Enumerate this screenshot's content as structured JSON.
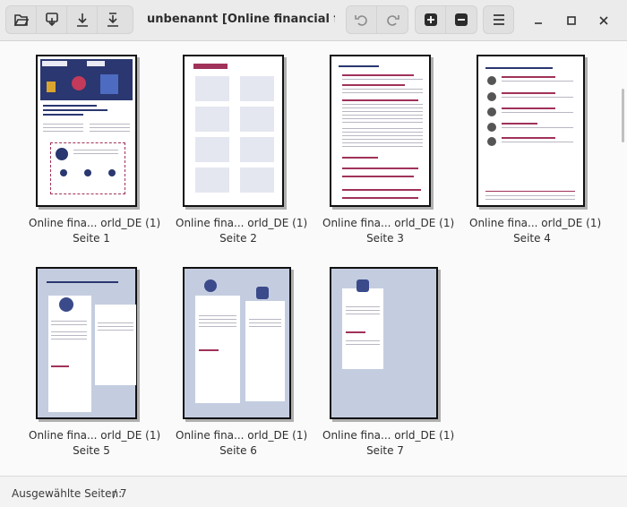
{
  "header": {
    "title": "unbenannt [Online financial frauds ...",
    "buttons": {
      "open": "folder-open-icon",
      "save": "save-icon",
      "download": "download-icon",
      "download_to": "download-to-icon",
      "undo": "undo-icon",
      "redo": "redo-icon",
      "zoom_in": "plus-icon",
      "zoom_out": "minus-icon",
      "menu": "hamburger-menu-icon"
    }
  },
  "pages": [
    {
      "name": "Online fina... orld_DE (1)",
      "label": "Seite 1"
    },
    {
      "name": "Online fina... orld_DE (1)",
      "label": "Seite 2"
    },
    {
      "name": "Online fina... orld_DE (1)",
      "label": "Seite 3"
    },
    {
      "name": "Online fina... orld_DE (1)",
      "label": "Seite 4"
    },
    {
      "name": "Online fina... orld_DE (1)",
      "label": "Seite 5"
    },
    {
      "name": "Online fina... orld_DE (1)",
      "label": "Seite 6"
    },
    {
      "name": "Online fina... orld_DE (1)",
      "label": "Seite 7"
    }
  ],
  "footer": {
    "selected_label": "Ausgewählte Seiten:",
    "selected_count": "/ 7"
  },
  "colors": {
    "accent_magenta": "#a0325a",
    "page_blue": "#c4cde0",
    "header_bg": "#ebebeb"
  }
}
